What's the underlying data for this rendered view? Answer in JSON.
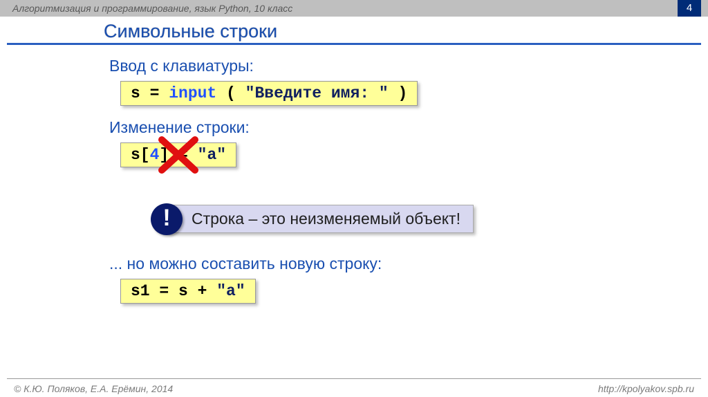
{
  "header": {
    "course": "Алгоритмизация и программирование, язык Python, 10 класс",
    "page": "4"
  },
  "title": "Символьные строки",
  "section1": "Ввод с клавиатуры:",
  "code1": {
    "p1": "s = ",
    "fn": "input",
    "p2": " ( ",
    "str": "\"Введите имя: \"",
    "p3": " )"
  },
  "section2": "Изменение строки:",
  "code2": {
    "p1": "s[",
    "idx": "4",
    "p2": "] = ",
    "str": "\"а\""
  },
  "note": {
    "bang": "!",
    "text": "Строка – это неизменяемый объект!"
  },
  "section3": "... но можно составить новую строку:",
  "code3": {
    "p1": "s1 = s + ",
    "str": "\"а\""
  },
  "footer": {
    "copyright": "© К.Ю. Поляков, Е.А. Ерёмин, 2014",
    "url": "http://kpolyakov.spb.ru"
  }
}
